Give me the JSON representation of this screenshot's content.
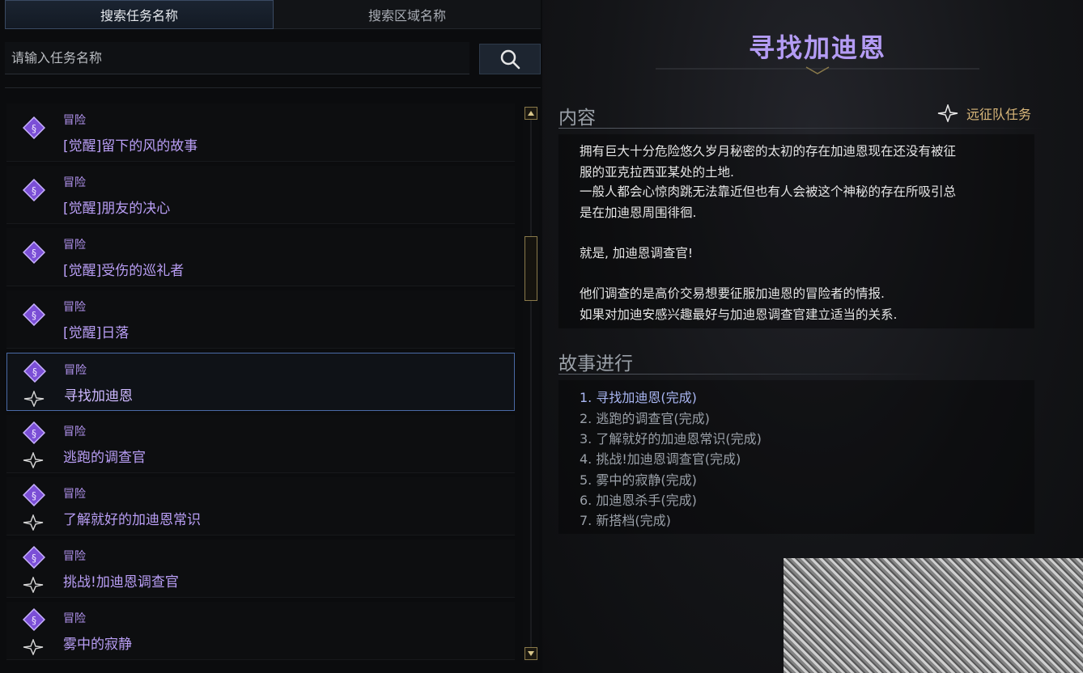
{
  "tabs": [
    {
      "label": "搜索任务名称",
      "active": true
    },
    {
      "label": "搜索区域名称",
      "active": false
    }
  ],
  "search": {
    "placeholder": "请输入任务名称",
    "value": ""
  },
  "quests": [
    {
      "category": "冒险",
      "name": "[觉醒]留下的风的故事",
      "expedition": false,
      "selected": false
    },
    {
      "category": "冒险",
      "name": "[觉醒]朋友的决心",
      "expedition": false,
      "selected": false
    },
    {
      "category": "冒险",
      "name": "[觉醒]受伤的巡礼者",
      "expedition": false,
      "selected": false
    },
    {
      "category": "冒险",
      "name": "[觉醒]日落",
      "expedition": false,
      "selected": false
    },
    {
      "category": "冒险",
      "name": "寻找加迪恩",
      "expedition": true,
      "selected": true
    },
    {
      "category": "冒险",
      "name": "逃跑的调查官",
      "expedition": true,
      "selected": false
    },
    {
      "category": "冒险",
      "name": "了解就好的加迪恩常识",
      "expedition": true,
      "selected": false
    },
    {
      "category": "冒险",
      "name": "挑战!加迪恩调查官",
      "expedition": true,
      "selected": false
    },
    {
      "category": "冒险",
      "name": "雾中的寂静",
      "expedition": true,
      "selected": false
    }
  ],
  "detail": {
    "title": "寻找加迪恩",
    "content_heading": "内容",
    "expedition_label": "远征队任务",
    "paragraphs": [
      "拥有巨大十分危险悠久岁月秘密的太初的存在加迪恩现在还没有被征",
      "服的亚克拉西亚某处的土地.",
      "一般人都会心惊肉跳无法靠近但也有人会被这个神秘的存在所吸引总",
      "是在加迪恩周围徘徊.",
      "就是, 加迪恩调查官!",
      "他们调查的是高价交易想要征服加迪恩的冒险者的情报.",
      "如果对加迪安感兴趣最好与加迪恩调查官建立适当的关系."
    ],
    "story_heading": "故事进行",
    "steps": [
      "1. 寻找加迪恩(完成)",
      "2. 逃跑的调查官(完成)",
      "3. 了解就好的加迪恩常识(完成)",
      "4. 挑战!加迪恩调查官(完成)",
      "5. 雾中的寂静(完成)",
      "6. 加迪恩杀手(完成)",
      "7. 新搭档(完成)"
    ]
  },
  "colors": {
    "quest_purple": "#b99ef5",
    "title_purple": "#b49cf4",
    "gold": "#d9b77a",
    "select_border": "#4a6aa6"
  },
  "icons": [
    "quest-badge-icon",
    "expedition-star-icon",
    "search-icon",
    "scroll-up-icon",
    "scroll-down-icon"
  ]
}
